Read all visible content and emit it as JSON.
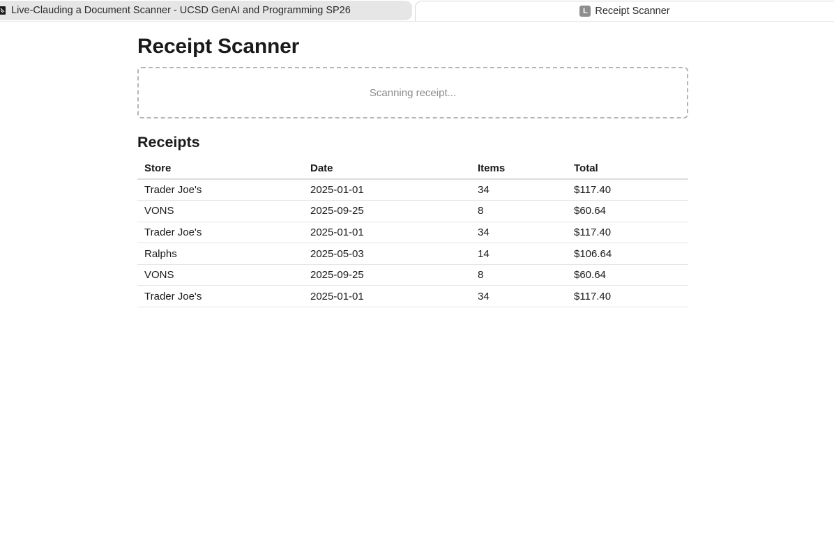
{
  "tabs": {
    "inactive": {
      "label": "Live-Clauding a Document Scanner - UCSD GenAI and Programming SP26",
      "icon": "notebook-icon"
    },
    "active": {
      "label": "Receipt Scanner",
      "favicon_letter": "L"
    }
  },
  "page": {
    "title": "Receipt Scanner",
    "dropzone_text": "Scanning receipt...",
    "section_title": "Receipts"
  },
  "table": {
    "headers": {
      "store": "Store",
      "date": "Date",
      "items": "Items",
      "total": "Total"
    },
    "rows": [
      {
        "store": "Trader Joe's",
        "date": "2025-01-01",
        "items": "34",
        "total": "$117.40"
      },
      {
        "store": "VONS",
        "date": "2025-09-25",
        "items": "8",
        "total": "$60.64"
      },
      {
        "store": "Trader Joe's",
        "date": "2025-01-01",
        "items": "34",
        "total": "$117.40"
      },
      {
        "store": "Ralphs",
        "date": "2025-05-03",
        "items": "14",
        "total": "$106.64"
      },
      {
        "store": "VONS",
        "date": "2025-09-25",
        "items": "8",
        "total": "$60.64"
      },
      {
        "store": "Trader Joe's",
        "date": "2025-01-01",
        "items": "34",
        "total": "$117.40"
      }
    ]
  }
}
